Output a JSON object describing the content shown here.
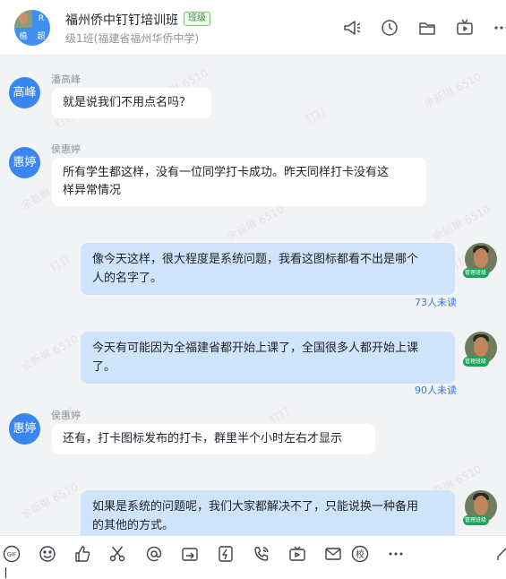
{
  "header": {
    "avatar_cells": [
      "R",
      "植",
      "超"
    ],
    "title": "福州侨中钉钉培训班",
    "tag": "班级",
    "subtitle": "级1班(福建省福州华侨中学)",
    "icons": [
      "megaphone-icon",
      "clock-icon",
      "folder-icon",
      "tv-icon",
      "more-icon"
    ]
  },
  "watermarks": [
    "余新琳 6510",
    "钉钉"
  ],
  "messages": [
    {
      "direction": "in",
      "avatar": "高峰",
      "sender": "潘高峰",
      "text": "就是说我们不用点名吗？"
    },
    {
      "direction": "in",
      "avatar": "惠婷",
      "sender": "侯惠婷",
      "text_lines": [
        "所有学生都这样，没有一位同学打卡成功。昨天同样打卡没有这",
        "样异常情况"
      ]
    },
    {
      "direction": "out",
      "text_lines": [
        "像今天这样，很大程度是系统问题，我看这图标都看不出是哪个",
        "人的名字了。"
      ],
      "read_status": "73人未读",
      "badge": "管理班级"
    },
    {
      "direction": "out",
      "text_lines": [
        "今天有可能因为全福建省都开始上课了，全国很多人都开始上课",
        "了。"
      ],
      "read_status": "90人未读",
      "badge": "管理班级"
    },
    {
      "direction": "in",
      "avatar": "惠婷",
      "sender": "侯惠婷",
      "text": "还有，打卡图标发布的打卡，群里半个小时左右才显示"
    },
    {
      "direction": "out",
      "text_lines": [
        "如果是系统的问题呢，我们大家都解决不了，只能说换一种备用",
        "的其他的方式。"
      ],
      "badge": "管理班级"
    }
  ],
  "toolbar": {
    "gif_label": "GIF",
    "school_label": "校",
    "icons": [
      "gif-icon",
      "emoji-icon",
      "thumbs-up-icon",
      "scissors-icon",
      "mention-icon",
      "forward-icon",
      "lightning-icon",
      "phone-icon",
      "video-icon",
      "mail-icon",
      "school-icon",
      "more-icon",
      "edit-icon"
    ]
  },
  "colors": {
    "accent": "#3a86f0",
    "bubble_out": "#cfe3fb",
    "read_status": "#2f7ae6",
    "badge": "#1aa35a"
  }
}
